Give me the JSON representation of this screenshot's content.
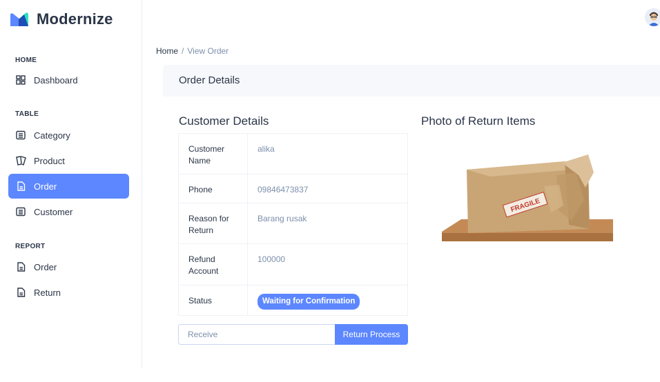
{
  "brand": {
    "name": "Modernize"
  },
  "sidebar": {
    "sections": [
      {
        "label": "HOME"
      },
      {
        "label": "TABLE"
      },
      {
        "label": "REPORT"
      }
    ],
    "items": [
      {
        "label": "Dashboard",
        "icon": "dashboard-icon"
      },
      {
        "label": "Category",
        "icon": "list-icon"
      },
      {
        "label": "Product",
        "icon": "tag-icon"
      },
      {
        "label": "Order",
        "icon": "file-icon",
        "active": true
      },
      {
        "label": "Customer",
        "icon": "list-icon"
      },
      {
        "label": "Order",
        "icon": "file-icon"
      },
      {
        "label": "Return",
        "icon": "file-icon"
      }
    ]
  },
  "breadcrumb": {
    "home": "Home",
    "separator": "/",
    "current": "View Order"
  },
  "card": {
    "title": "Order Details"
  },
  "customer": {
    "title": "Customer Details",
    "rows": [
      {
        "key": "Customer Name",
        "value": "alika"
      },
      {
        "key": "Phone",
        "value": "09846473837"
      },
      {
        "key": "Reason for Return",
        "value": "Barang rusak"
      },
      {
        "key": "Refund Account",
        "value": "100000"
      },
      {
        "key": "Status",
        "value": "Waiting for Confirmation"
      }
    ]
  },
  "photo": {
    "title": "Photo of Return Items",
    "label": "FRAGILE"
  },
  "action": {
    "placeholder": "Receive",
    "button_label": "Return Process"
  },
  "colors": {
    "accent": "#5d87ff",
    "text": "#2a3547",
    "muted": "#7c8fac"
  }
}
